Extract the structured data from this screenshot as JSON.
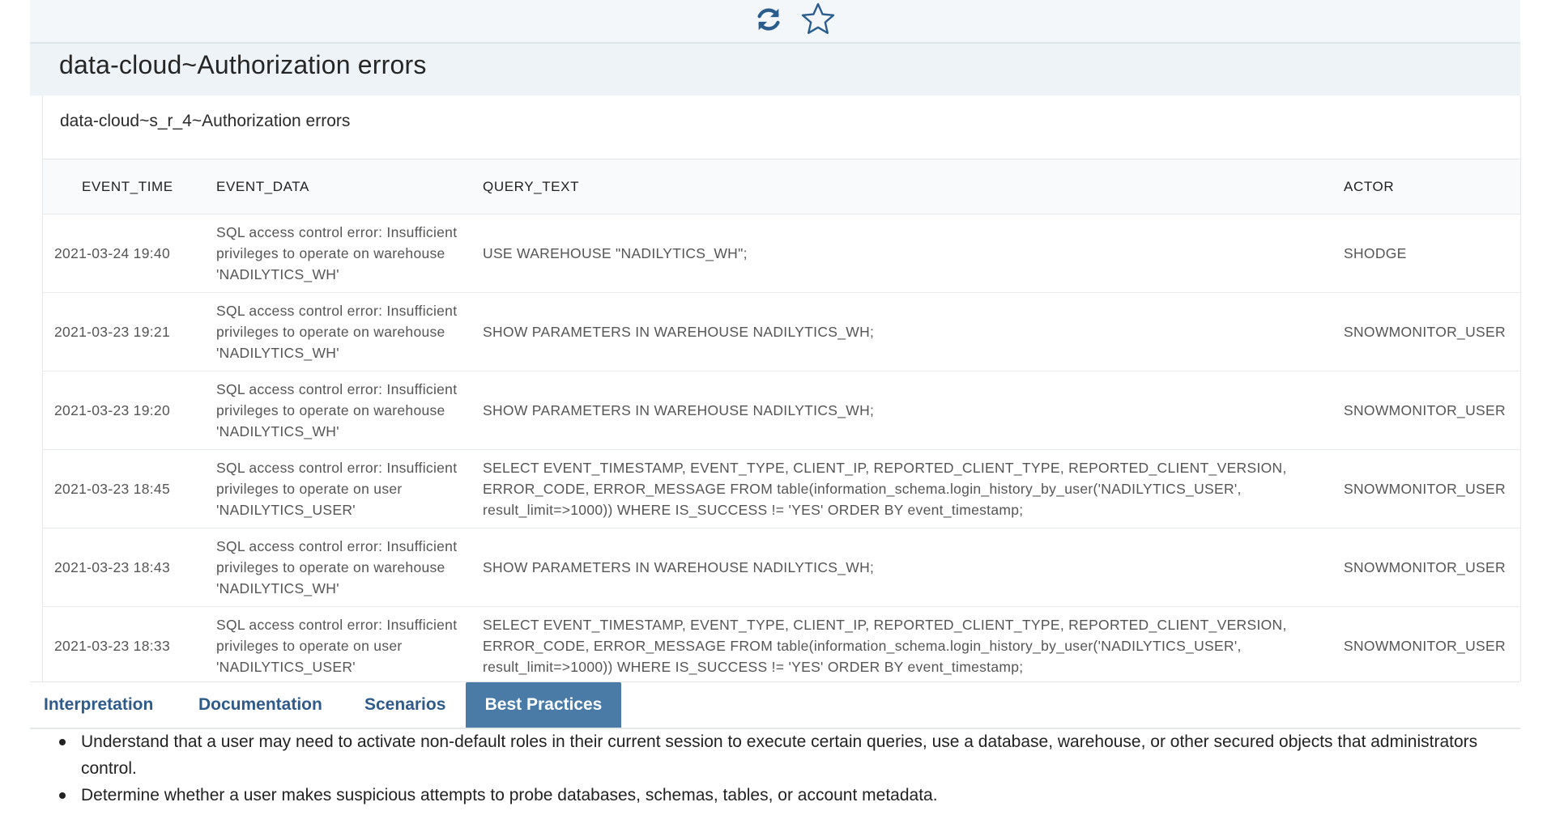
{
  "header": {
    "icons": [
      "refresh-icon",
      "star-icon"
    ]
  },
  "page_title": "data-cloud~Authorization errors",
  "panel": {
    "subtitle": "data-cloud~s_r_4~Authorization errors"
  },
  "table": {
    "columns": [
      "EVENT_TIME",
      "EVENT_DATA",
      "QUERY_TEXT",
      "ACTOR"
    ],
    "rows": [
      {
        "event_time": "2021-03-24 19:40",
        "event_data": "SQL access control error: Insufficient privileges to operate on warehouse 'NADILYTICS_WH'",
        "query_text": "USE WAREHOUSE \"NADILYTICS_WH\";",
        "actor": "SHODGE"
      },
      {
        "event_time": "2021-03-23 19:21",
        "event_data": "SQL access control error: Insufficient privileges to operate on warehouse 'NADILYTICS_WH'",
        "query_text": "SHOW PARAMETERS IN WAREHOUSE NADILYTICS_WH;",
        "actor": "SNOWMONITOR_USER"
      },
      {
        "event_time": "2021-03-23 19:20",
        "event_data": "SQL access control error: Insufficient privileges to operate on warehouse 'NADILYTICS_WH'",
        "query_text": "SHOW PARAMETERS IN WAREHOUSE NADILYTICS_WH;",
        "actor": "SNOWMONITOR_USER"
      },
      {
        "event_time": "2021-03-23 18:45",
        "event_data": "SQL access control error: Insufficient privileges to operate on user 'NADILYTICS_USER'",
        "query_text": "SELECT EVENT_TIMESTAMP, EVENT_TYPE, CLIENT_IP, REPORTED_CLIENT_TYPE, REPORTED_CLIENT_VERSION, ERROR_CODE, ERROR_MESSAGE FROM table(information_schema.login_history_by_user('NADILYTICS_USER', result_limit=>1000)) WHERE IS_SUCCESS != 'YES' ORDER BY event_timestamp;",
        "actor": "SNOWMONITOR_USER"
      },
      {
        "event_time": "2021-03-23 18:43",
        "event_data": "SQL access control error: Insufficient privileges to operate on warehouse 'NADILYTICS_WH'",
        "query_text": "SHOW PARAMETERS IN WAREHOUSE NADILYTICS_WH;",
        "actor": "SNOWMONITOR_USER"
      },
      {
        "event_time": "2021-03-23 18:33",
        "event_data": "SQL access control error: Insufficient privileges to operate on user 'NADILYTICS_USER'",
        "query_text": "SELECT EVENT_TIMESTAMP, EVENT_TYPE, CLIENT_IP, REPORTED_CLIENT_TYPE, REPORTED_CLIENT_VERSION, ERROR_CODE, ERROR_MESSAGE FROM table(information_schema.login_history_by_user('NADILYTICS_USER', result_limit=>1000)) WHERE IS_SUCCESS != 'YES' ORDER BY event_timestamp;",
        "actor": "SNOWMONITOR_USER"
      }
    ]
  },
  "tabs": [
    {
      "label": "Interpretation",
      "active": false
    },
    {
      "label": "Documentation",
      "active": false
    },
    {
      "label": "Scenarios",
      "active": false
    },
    {
      "label": "Best Practices",
      "active": true
    }
  ],
  "best_practices": [
    "Understand that a user may need to activate non-default roles in their current session to execute certain queries, use a database, warehouse, or other secured objects that administrators control.",
    "Determine whether a user makes suspicious attempts to probe databases, schemas, tables, or account metadata."
  ],
  "colors": {
    "accent": "#4a7ba7",
    "tab_text": "#2f5b8a",
    "header_bg": "#edf3f7",
    "icon": "#2a5d8c"
  }
}
